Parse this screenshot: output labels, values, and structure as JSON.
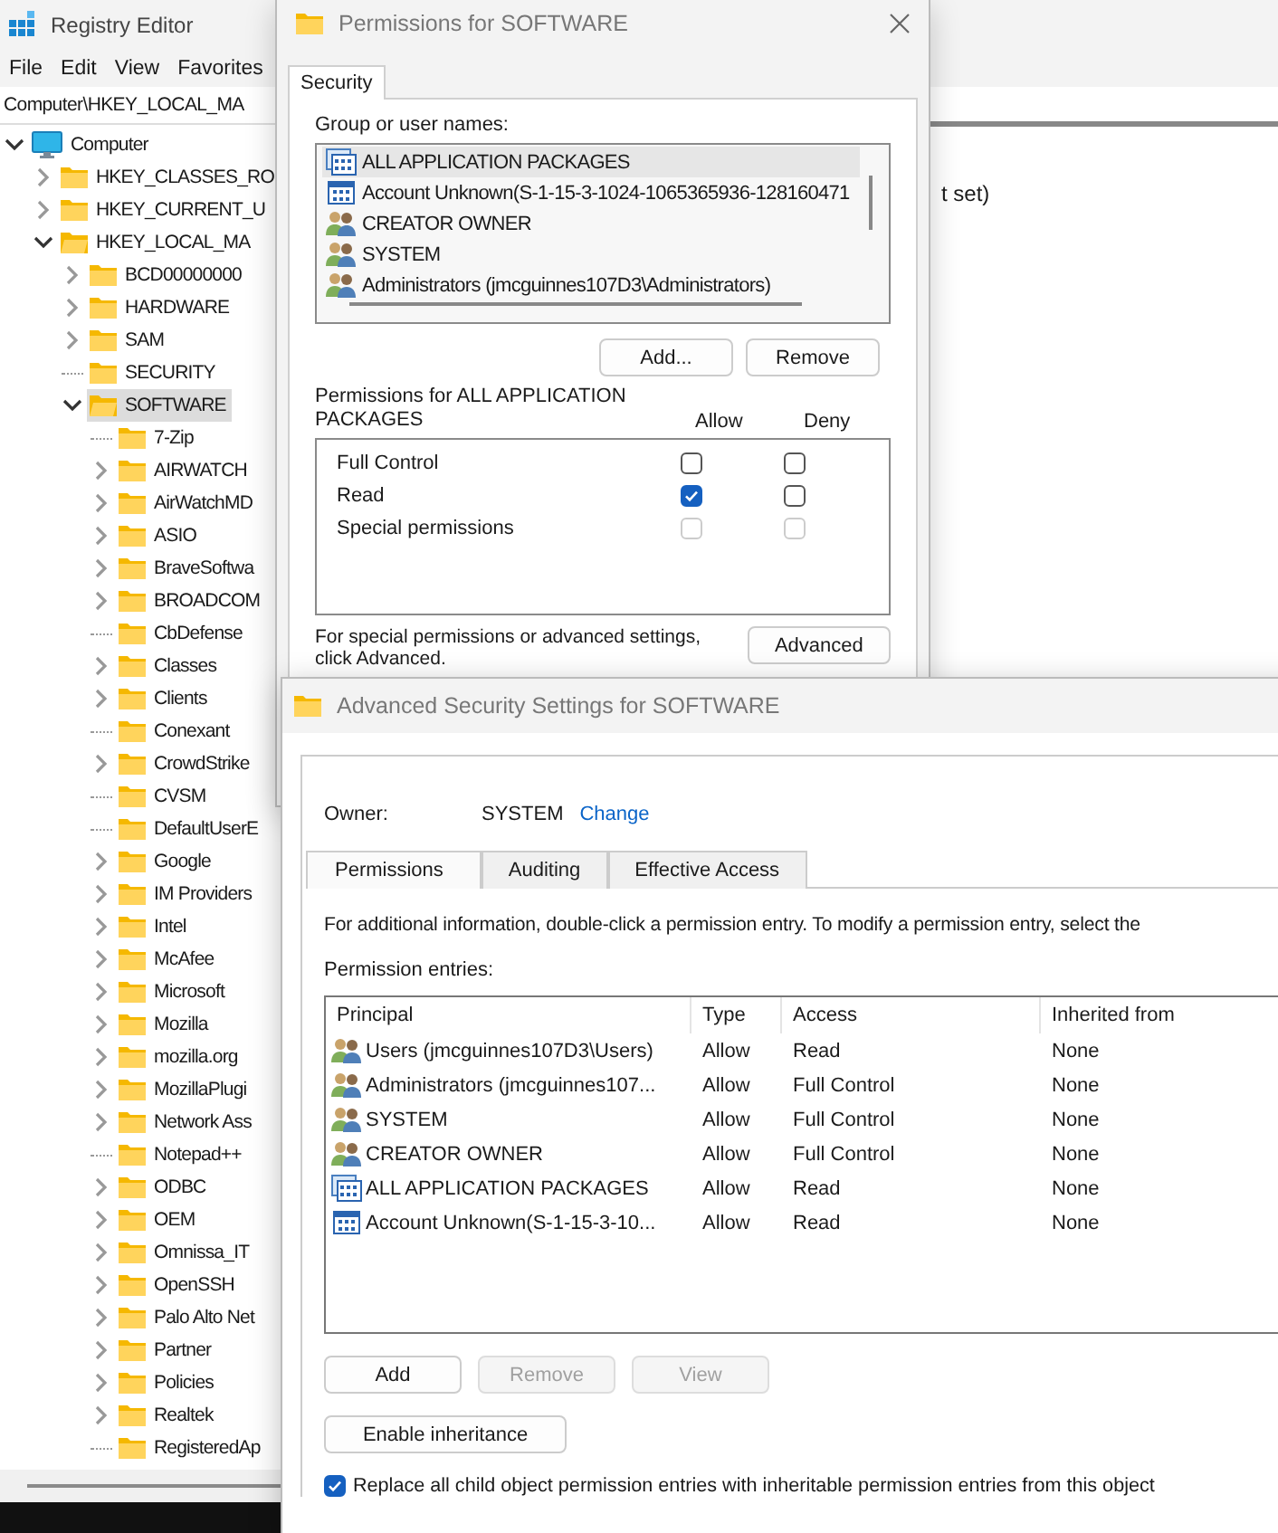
{
  "registry": {
    "title": "Registry Editor",
    "menu": [
      "File",
      "Edit",
      "View",
      "Favorites"
    ],
    "address": "Computer\\HKEY_LOCAL_MA",
    "value_text": "t set)",
    "tree": [
      {
        "label": "Computer",
        "kind": "computer",
        "expandable": true,
        "expanded": true,
        "selected": false,
        "children": [
          {
            "label": "HKEY_CLASSES_RO",
            "kind": "folder",
            "expandable": true,
            "expanded": false,
            "selected": false
          },
          {
            "label": "HKEY_CURRENT_U",
            "kind": "folder",
            "expandable": true,
            "expanded": false,
            "selected": false
          },
          {
            "label": "HKEY_LOCAL_MA",
            "kind": "folder",
            "expandable": true,
            "expanded": true,
            "selected": false,
            "children": [
              {
                "label": "BCD00000000",
                "kind": "folder",
                "expandable": true,
                "expanded": false,
                "selected": false
              },
              {
                "label": "HARDWARE",
                "kind": "folder",
                "expandable": true,
                "expanded": false,
                "selected": false
              },
              {
                "label": "SAM",
                "kind": "folder",
                "expandable": true,
                "expanded": false,
                "selected": false
              },
              {
                "label": "SECURITY",
                "kind": "folder",
                "expandable": false,
                "expanded": false,
                "selected": false
              },
              {
                "label": "SOFTWARE",
                "kind": "folder",
                "expandable": true,
                "expanded": true,
                "selected": true,
                "children": [
                  {
                    "label": "7-Zip",
                    "kind": "folder",
                    "expandable": false,
                    "expanded": false,
                    "selected": false
                  },
                  {
                    "label": "AIRWATCH",
                    "kind": "folder",
                    "expandable": true,
                    "expanded": false,
                    "selected": false
                  },
                  {
                    "label": "AirWatchMD",
                    "kind": "folder",
                    "expandable": true,
                    "expanded": false,
                    "selected": false
                  },
                  {
                    "label": "ASIO",
                    "kind": "folder",
                    "expandable": true,
                    "expanded": false,
                    "selected": false
                  },
                  {
                    "label": "BraveSoftwa",
                    "kind": "folder",
                    "expandable": true,
                    "expanded": false,
                    "selected": false
                  },
                  {
                    "label": "BROADCOM",
                    "kind": "folder",
                    "expandable": true,
                    "expanded": false,
                    "selected": false
                  },
                  {
                    "label": "CbDefense",
                    "kind": "folder",
                    "expandable": false,
                    "expanded": false,
                    "selected": false
                  },
                  {
                    "label": "Classes",
                    "kind": "folder",
                    "expandable": true,
                    "expanded": false,
                    "selected": false
                  },
                  {
                    "label": "Clients",
                    "kind": "folder",
                    "expandable": true,
                    "expanded": false,
                    "selected": false
                  },
                  {
                    "label": "Conexant",
                    "kind": "folder",
                    "expandable": false,
                    "expanded": false,
                    "selected": false
                  },
                  {
                    "label": "CrowdStrike",
                    "kind": "folder",
                    "expandable": true,
                    "expanded": false,
                    "selected": false
                  },
                  {
                    "label": "CVSM",
                    "kind": "folder",
                    "expandable": false,
                    "expanded": false,
                    "selected": false
                  },
                  {
                    "label": "DefaultUserE",
                    "kind": "folder",
                    "expandable": false,
                    "expanded": false,
                    "selected": false
                  },
                  {
                    "label": "Google",
                    "kind": "folder",
                    "expandable": true,
                    "expanded": false,
                    "selected": false
                  },
                  {
                    "label": "IM Providers",
                    "kind": "folder",
                    "expandable": true,
                    "expanded": false,
                    "selected": false
                  },
                  {
                    "label": "Intel",
                    "kind": "folder",
                    "expandable": true,
                    "expanded": false,
                    "selected": false
                  },
                  {
                    "label": "McAfee",
                    "kind": "folder",
                    "expandable": true,
                    "expanded": false,
                    "selected": false
                  },
                  {
                    "label": "Microsoft",
                    "kind": "folder",
                    "expandable": true,
                    "expanded": false,
                    "selected": false
                  },
                  {
                    "label": "Mozilla",
                    "kind": "folder",
                    "expandable": true,
                    "expanded": false,
                    "selected": false
                  },
                  {
                    "label": "mozilla.org",
                    "kind": "folder",
                    "expandable": true,
                    "expanded": false,
                    "selected": false
                  },
                  {
                    "label": "MozillaPlugi",
                    "kind": "folder",
                    "expandable": true,
                    "expanded": false,
                    "selected": false
                  },
                  {
                    "label": "Network Ass",
                    "kind": "folder",
                    "expandable": true,
                    "expanded": false,
                    "selected": false
                  },
                  {
                    "label": "Notepad++",
                    "kind": "folder",
                    "expandable": false,
                    "expanded": false,
                    "selected": false
                  },
                  {
                    "label": "ODBC",
                    "kind": "folder",
                    "expandable": true,
                    "expanded": false,
                    "selected": false
                  },
                  {
                    "label": "OEM",
                    "kind": "folder",
                    "expandable": true,
                    "expanded": false,
                    "selected": false
                  },
                  {
                    "label": "Omnissa_IT",
                    "kind": "folder",
                    "expandable": true,
                    "expanded": false,
                    "selected": false
                  },
                  {
                    "label": "OpenSSH",
                    "kind": "folder",
                    "expandable": true,
                    "expanded": false,
                    "selected": false
                  },
                  {
                    "label": "Palo Alto Net",
                    "kind": "folder",
                    "expandable": true,
                    "expanded": false,
                    "selected": false
                  },
                  {
                    "label": "Partner",
                    "kind": "folder",
                    "expandable": true,
                    "expanded": false,
                    "selected": false
                  },
                  {
                    "label": "Policies",
                    "kind": "folder",
                    "expandable": true,
                    "expanded": false,
                    "selected": false
                  },
                  {
                    "label": "Realtek",
                    "kind": "folder",
                    "expandable": true,
                    "expanded": false,
                    "selected": false
                  },
                  {
                    "label": "RegisteredAp",
                    "kind": "folder",
                    "expandable": false,
                    "expanded": false,
                    "selected": false
                  }
                ]
              }
            ]
          }
        ]
      }
    ]
  },
  "permissions_dialog": {
    "title": "Permissions for SOFTWARE",
    "tabs": [
      {
        "label": "Security",
        "selected": true
      }
    ],
    "group_label": "Group or user names:",
    "principals": [
      {
        "name": "ALL APPLICATION PACKAGES",
        "kind": "packages",
        "selected": true
      },
      {
        "name": "Account Unknown(S-1-15-3-1024-1065365936-128160471",
        "kind": "account",
        "selected": false
      },
      {
        "name": "CREATOR OWNER",
        "kind": "group",
        "selected": false
      },
      {
        "name": "SYSTEM",
        "kind": "group",
        "selected": false
      },
      {
        "name": "Administrators (jmcguinnes107D3\\Administrators)",
        "kind": "group",
        "selected": false
      }
    ],
    "buttons": [
      "Add...",
      "Remove"
    ],
    "permissions_label": "Permissions for ALL APPLICATION PACKAGES",
    "allow_header": "Allow",
    "deny_header": "Deny",
    "permissions": [
      {
        "name": "Full Control",
        "allow": {
          "checked": false,
          "disabled": false
        },
        "deny": {
          "checked": false,
          "disabled": false
        }
      },
      {
        "name": "Read",
        "allow": {
          "checked": true,
          "disabled": false
        },
        "deny": {
          "checked": false,
          "disabled": false
        }
      },
      {
        "name": "Special permissions",
        "allow": {
          "checked": false,
          "disabled": true
        },
        "deny": {
          "checked": false,
          "disabled": true
        }
      }
    ],
    "advanced_hint": "For special permissions or advanced settings, click Advanced.",
    "advanced_button": "Advanced"
  },
  "advanced_dialog": {
    "title": "Advanced Security Settings for SOFTWARE",
    "owner_label": "Owner:",
    "owner": "SYSTEM",
    "change_link": "Change",
    "tabs": [
      {
        "label": "Permissions",
        "selected": true
      },
      {
        "label": "Auditing",
        "selected": false
      },
      {
        "label": "Effective Access",
        "selected": false
      }
    ],
    "info": "For additional information, double-click a permission entry. To modify a permission entry, select the",
    "entries_label": "Permission entries:",
    "columns": [
      "Principal",
      "Type",
      "Access",
      "Inherited from"
    ],
    "entries": [
      {
        "principal": "Users (jmcguinnes107D3\\Users)",
        "kind": "group",
        "type": "Allow",
        "access": "Read",
        "inherited_from": "None"
      },
      {
        "principal": "Administrators (jmcguinnes107...",
        "kind": "group",
        "type": "Allow",
        "access": "Full Control",
        "inherited_from": "None"
      },
      {
        "principal": "SYSTEM",
        "kind": "group",
        "type": "Allow",
        "access": "Full Control",
        "inherited_from": "None"
      },
      {
        "principal": "CREATOR OWNER",
        "kind": "group",
        "type": "Allow",
        "access": "Full Control",
        "inherited_from": "None"
      },
      {
        "principal": "ALL APPLICATION PACKAGES",
        "kind": "packages",
        "type": "Allow",
        "access": "Read",
        "inherited_from": "None"
      },
      {
        "principal": "Account Unknown(S-1-15-3-10...",
        "kind": "account",
        "type": "Allow",
        "access": "Read",
        "inherited_from": "None"
      }
    ],
    "buttons": [
      {
        "label": "Add",
        "disabled": false
      },
      {
        "label": "Remove",
        "disabled": true
      },
      {
        "label": "View",
        "disabled": true
      }
    ],
    "enable_inheritance": "Enable inheritance",
    "replace_option": {
      "label": "Replace all child object permission entries with inheritable permission entries from this object",
      "checked": true
    }
  }
}
